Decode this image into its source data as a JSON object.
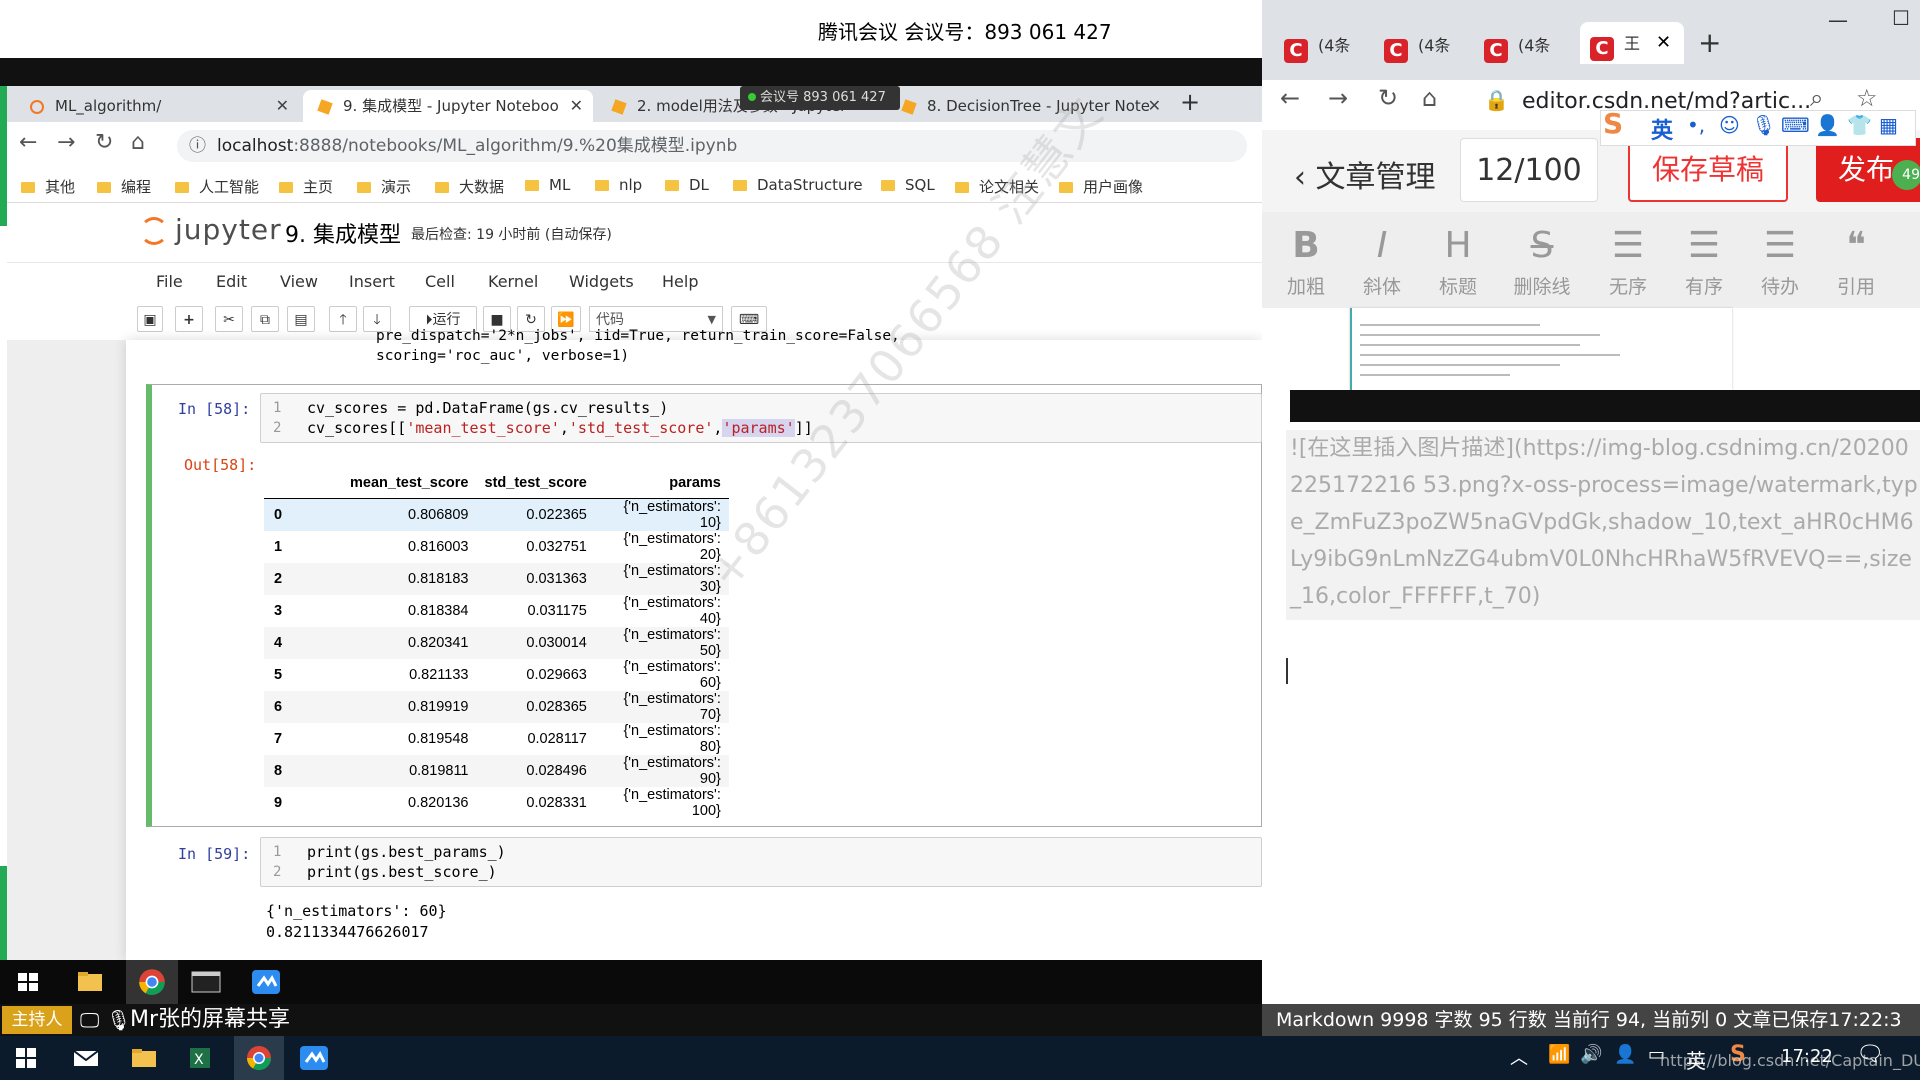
{
  "meeting": {
    "top_title": "腾讯会议 会议号：893 061 427",
    "pill": "会议号 893 061 427"
  },
  "left_browser": {
    "tabs": [
      {
        "label": "ML_algorithm/"
      },
      {
        "label": "9. 集成模型 - Jupyter Noteboo"
      },
      {
        "label": "2. model用法及参数 - Jupyter"
      },
      {
        "label": "8. DecisionTree - Jupyter Note"
      }
    ],
    "url_host": "localhost",
    "url_rest": ":8888/notebooks/ML_algorithm/9.%20集成模型.ipynb",
    "bookmarks": [
      "其他",
      "编程",
      "人工智能",
      "主页",
      "演示",
      "大数据",
      "ML",
      "nlp",
      "DL",
      "DataStructure",
      "SQL",
      "论文相关",
      "用户画像"
    ]
  },
  "jupyter": {
    "logo_text": "jupyter",
    "notebook_title": "9. 集成模型",
    "checkpoint": "最后检查: 19 小时前  (自动保存)",
    "menu": [
      "File",
      "Edit",
      "View",
      "Insert",
      "Cell",
      "Kernel",
      "Widgets",
      "Help"
    ],
    "toolbar": {
      "run_label": "运行",
      "cell_type": "代码"
    },
    "prev_code": [
      "pre_dispatch='2*n_jobs', iid=True, return_train_score=False,",
      "scoring='roc_auc', verbose=1)"
    ],
    "cell58": {
      "in_prompt": "In  [58]:",
      "out_prompt": "Out[58]:",
      "line1": "cv_scores = pd.DataFrame(gs.cv_results_)",
      "line2_a": "cv_scores[[",
      "line2_s1": "'mean_test_score'",
      "line2_c1": ",",
      "line2_s2": "'std_test_score'",
      "line2_c2": ",",
      "line2_s3": "'params'",
      "line2_end": "]]",
      "table": {
        "headers": [
          "",
          "mean_test_score",
          "std_test_score",
          "params"
        ],
        "rows": [
          [
            "0",
            "0.806809",
            "0.022365",
            "{'n_estimators': 10}"
          ],
          [
            "1",
            "0.816003",
            "0.032751",
            "{'n_estimators': 20}"
          ],
          [
            "2",
            "0.818183",
            "0.031363",
            "{'n_estimators': 30}"
          ],
          [
            "3",
            "0.818384",
            "0.031175",
            "{'n_estimators': 40}"
          ],
          [
            "4",
            "0.820341",
            "0.030014",
            "{'n_estimators': 50}"
          ],
          [
            "5",
            "0.821133",
            "0.029663",
            "{'n_estimators': 60}"
          ],
          [
            "6",
            "0.819919",
            "0.028365",
            "{'n_estimators': 70}"
          ],
          [
            "7",
            "0.819548",
            "0.028117",
            "{'n_estimators': 80}"
          ],
          [
            "8",
            "0.819811",
            "0.028496",
            "{'n_estimators': 90}"
          ],
          [
            "9",
            "0.820136",
            "0.028331",
            "{'n_estimators': 100}"
          ]
        ]
      }
    },
    "cell59": {
      "in_prompt": "In  [59]:",
      "line1": "print(gs.best_params_)",
      "line2": "print(gs.best_score_)",
      "out1": "{'n_estimators': 60}",
      "out2": "0.8211334476626017"
    },
    "watermark": "+8613237066568 汪慧文"
  },
  "right_browser": {
    "tab_label": "(4条",
    "active_tab_label": "王",
    "url": "editor.csdn.net/md?artic...",
    "article_manage": "文章管理",
    "word_count": "12/100",
    "save_draft": "保存草稿",
    "publish": "发布",
    "badge": "49",
    "ime": "英",
    "toolbar": [
      {
        "glyph": "B",
        "label": "加粗"
      },
      {
        "glyph": "I",
        "label": "斜体"
      },
      {
        "glyph": "H",
        "label": "标题"
      },
      {
        "glyph": "S",
        "label": "删除线"
      },
      {
        "glyph": "☰",
        "label": "无序"
      },
      {
        "glyph": "☰",
        "label": "有序"
      },
      {
        "glyph": "☰",
        "label": "待办"
      },
      {
        "glyph": "❝",
        "label": "引用"
      }
    ],
    "markdown_text": "![在这里插入图片描述](https://img-blog.csdnimg.cn/20200225172216 53.png?x-oss-process=image/watermark,type_ZmFuZ3poZW5naGVpdGk,shadow_10,text_aHR0cHM6Ly9ibG9nLmNzZG4ubmV0L0NhcHRhaW5fRVEVQ==,size_16,color_FFFFFF,t_70)",
    "status": "Markdown   9998 字数   95 行数   当前行 94, 当前列 0   文章已保存17:22:3"
  },
  "share": {
    "host_label": "主持人",
    "title": "Mr张的屏幕共享"
  },
  "taskbar": {
    "tray_ime": "英",
    "time": "17:22",
    "tray_url": "https://blog.csdn.net/Captain_DUDU"
  },
  "colors": {
    "jupyter_orange": "#f37726",
    "cell_selected": "#66bb6a",
    "csdn_red": "#e01e1e",
    "host_gold": "#d9a21a"
  }
}
